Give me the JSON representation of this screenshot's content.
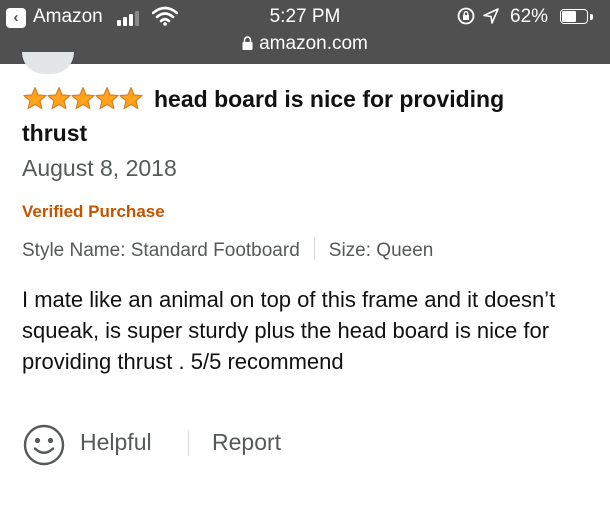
{
  "status_bar": {
    "back_label": "Amazon",
    "time": "5:27 PM",
    "battery": "62%",
    "battery_level": 0.62
  },
  "url_bar": {
    "domain": "amazon.com"
  },
  "review": {
    "rating": 5,
    "rating_max": 5,
    "title_line1": "head board is nice for providing",
    "title_line2": "thrust",
    "date": "August 8, 2018",
    "verified": "Verified Purchase",
    "style_name": "Style Name: Standard Footboard",
    "size": "Size: Queen",
    "body": "I mate like an animal on top of this frame and it doesn’t squeak, is super sturdy plus the head board is nice for providing thrust . 5/5 recommend"
  },
  "actions": {
    "helpful": "Helpful",
    "report": "Report"
  },
  "colors": {
    "star": "#ffa41c",
    "verified": "#c45500",
    "muted_text": "#565959",
    "status_bar_bg": "#505050"
  }
}
